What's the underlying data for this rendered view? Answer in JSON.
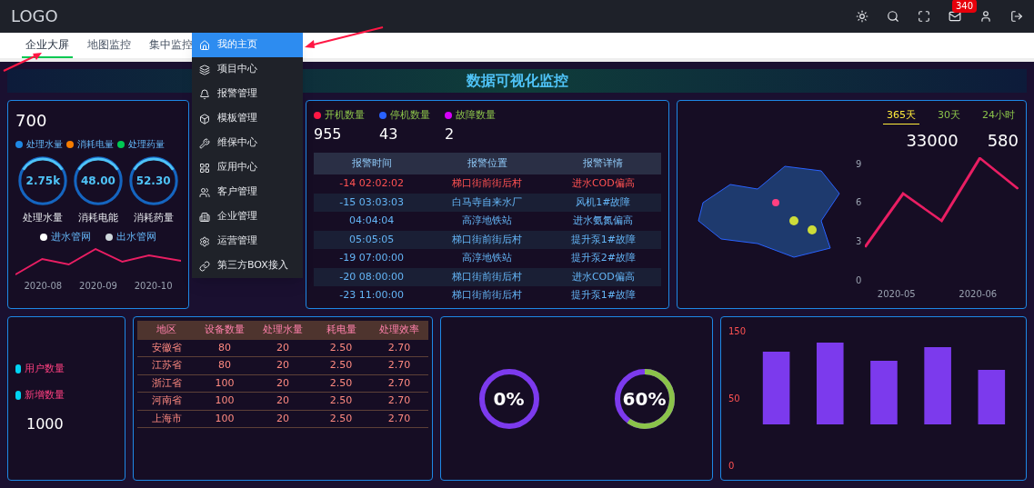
{
  "topbar": {
    "logo": "LOGO",
    "badge": "340"
  },
  "tabs": [
    {
      "label": "企业大屏",
      "selected": true
    },
    {
      "label": "地图监控",
      "selected": false
    },
    {
      "label": "集中监控",
      "selected": false
    }
  ],
  "menu": [
    {
      "label": "我的主页",
      "selected": true
    },
    {
      "label": "项目中心",
      "selected": false
    },
    {
      "label": "报警管理",
      "selected": false
    },
    {
      "label": "模板管理",
      "selected": false
    },
    {
      "label": "维保中心",
      "selected": false
    },
    {
      "label": "应用中心",
      "selected": false
    },
    {
      "label": "客户管理",
      "selected": false
    },
    {
      "label": "企业管理",
      "selected": false
    },
    {
      "label": "运营管理",
      "selected": false
    },
    {
      "label": "第三方BOX接入",
      "selected": false
    }
  ],
  "dashboard": {
    "title": "数据可视化监控",
    "left": {
      "stat": "700",
      "legend": [
        {
          "label": "处理水量",
          "color": "#1e88e5"
        },
        {
          "label": "消耗电量",
          "color": "#f57c00"
        },
        {
          "label": "处理药量",
          "color": "#00c853"
        }
      ],
      "gauges": [
        {
          "value": "2.75k",
          "label": "处理水量"
        },
        {
          "value": "48.00",
          "label": "消耗电能"
        },
        {
          "value": "52.30",
          "label": "消耗药量"
        }
      ],
      "line_legend": [
        {
          "label": "进水管网",
          "color": "#ffffff"
        },
        {
          "label": "出水管网",
          "color": "#cfd8dc"
        }
      ],
      "x_labels": [
        "2020-08",
        "2020-09",
        "2020-10"
      ]
    },
    "middle": {
      "machines": [
        {
          "label": "开机数量",
          "value": "955",
          "color": "#ff1744"
        },
        {
          "label": "停机数量",
          "value": "43",
          "color": "#2962ff"
        },
        {
          "label": "故障数量",
          "value": "2",
          "color": "#d500f9"
        }
      ],
      "alarm_table": {
        "columns": [
          "报警时间",
          "报警位置",
          "报警详情"
        ],
        "rows": [
          [
            "-14 02:02:02",
            "梯口街前街后村",
            "进水COD偏高"
          ],
          [
            "-15 03:03:03",
            "白马寺自来水厂",
            "风机1#故障"
          ],
          [
            "04:04:04",
            "高淳地铁站",
            "进水氨氮偏高"
          ],
          [
            "05:05:05",
            "梯口街前街后村",
            "提升泵1#故障"
          ],
          [
            "-19 07:00:00",
            "高淳地铁站",
            "提升泵2#故障"
          ],
          [
            "-20 08:00:00",
            "梯口街前街后村",
            "进水COD偏高"
          ],
          [
            "-23 11:00:00",
            "梯口街前街后村",
            "提升泵1#故障"
          ]
        ]
      }
    },
    "right": {
      "periods": [
        {
          "label": "365天",
          "selected": true
        },
        {
          "label": "30天",
          "selected": false
        },
        {
          "label": "24小时",
          "selected": false
        }
      ],
      "stats": [
        "33000",
        "580"
      ],
      "y_labels": [
        "9",
        "6",
        "3",
        "0"
      ],
      "x_labels": [
        "2020-05",
        "2020-06"
      ]
    },
    "bottom": {
      "users_label": "用户数量",
      "new_label": "新增数量",
      "new_value": "1000",
      "region_table": {
        "columns": [
          "地区",
          "设备数量",
          "处理水量",
          "耗电量",
          "处理效率"
        ],
        "rows": [
          [
            "安徽省",
            "80",
            "20",
            "2.50",
            "2.70"
          ],
          [
            "江苏省",
            "80",
            "20",
            "2.50",
            "2.70"
          ],
          [
            "浙江省",
            "100",
            "20",
            "2.50",
            "2.70"
          ],
          [
            "河南省",
            "100",
            "20",
            "2.50",
            "2.70"
          ],
          [
            "上海市",
            "100",
            "20",
            "2.50",
            "2.70"
          ]
        ]
      },
      "rings": [
        {
          "reading": "0%",
          "level": 0
        },
        {
          "reading": "60%",
          "level": 0.6
        }
      ],
      "bar_ticks": [
        "150",
        "50",
        "0"
      ]
    }
  }
}
